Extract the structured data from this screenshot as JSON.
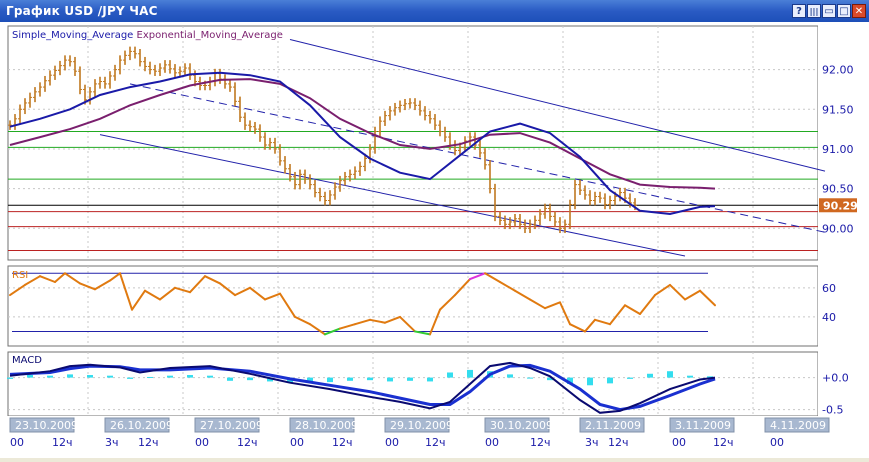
{
  "window": {
    "title": "График USD /JPY  ЧАС",
    "buttons": [
      "?",
      "|||",
      "▭",
      "□",
      "✕"
    ]
  },
  "colors": {
    "background": "#ffffff",
    "grid": "#c8c8c8",
    "price_bars": "#c07820",
    "sma": "#1a1aa8",
    "ema": "#7a1f6e",
    "channel": "#2222aa",
    "green_levels": "#22aa22",
    "red_levels": "#bb2222",
    "rsi": "#e07a10",
    "rsi_overbought": "#dd33dd",
    "rsi_oversold": "#33cc33",
    "macd_main": "#0a0a70",
    "macd_signal": "#1a30d0",
    "macd_hist": "#33ddee"
  },
  "chart_data": [
    {
      "type": "line",
      "title": "Simple_Moving_Average Exponential_Moving_Average",
      "legend": [
        "Simple_Moving_Average",
        "Exponential_Moving_Average"
      ],
      "ylim": [
        89.6,
        92.55
      ],
      "y_ticks": [
        "92.00",
        "91.50",
        "91.00",
        "90.50",
        "90.00"
      ],
      "last_price_label": "90.29",
      "horizontal_levels": {
        "green": [
          91.22,
          91.02,
          90.62
        ],
        "red": [
          90.21,
          90.02,
          89.72
        ],
        "black": [
          90.29
        ]
      },
      "x_axis_dates": [
        "23.10.2009",
        "26.10.2009",
        "27.10.2009",
        "28.10.2009",
        "29.10.2009",
        "30.10.2009",
        "2.11.2009",
        "3.11.2009",
        "4.11.2009"
      ],
      "x_axis_hours": [
        "00",
        "12ч",
        "3ч",
        "12ч",
        "00",
        "12ч",
        "00",
        "12ч",
        "00",
        "12ч",
        "00",
        "12ч",
        "3ч",
        "12ч",
        "00",
        "12ч",
        "00"
      ],
      "close_series": {
        "x": [
          0,
          5,
          10,
          15,
          20,
          25,
          30,
          35,
          40,
          45,
          50,
          55,
          60,
          65,
          70,
          75,
          80,
          85,
          90,
          95,
          100,
          105,
          110,
          115,
          120,
          125,
          130,
          135,
          140,
          145,
          150,
          155,
          160,
          165,
          170,
          175,
          180,
          185,
          190,
          195,
          200,
          205,
          210,
          215,
          220,
          225,
          230,
          235,
          240,
          245,
          250,
          255,
          260,
          265,
          270,
          275,
          280,
          285,
          290,
          295,
          300,
          305,
          310,
          315,
          320,
          325,
          330,
          335,
          340,
          345,
          350,
          355,
          360,
          365,
          370,
          375,
          380,
          385,
          390,
          395,
          400,
          405,
          410,
          415,
          420,
          425,
          430,
          435,
          440,
          445,
          450,
          455,
          460,
          465,
          470,
          475,
          480,
          485,
          490,
          495,
          500,
          505,
          510,
          515,
          520,
          525,
          530,
          535,
          540,
          545,
          550,
          555,
          560,
          565,
          570,
          575,
          580,
          585,
          590,
          595,
          600,
          605,
          610,
          615,
          620,
          625,
          630,
          635,
          640,
          645,
          650,
          655,
          660,
          665,
          670,
          675,
          680,
          685,
          690,
          695,
          700,
          705
        ],
        "values": [
          91.3,
          91.38,
          91.5,
          91.58,
          91.65,
          91.72,
          91.78,
          91.86,
          91.93,
          91.99,
          92.05,
          92.12,
          92.1,
          91.98,
          91.75,
          91.62,
          91.72,
          91.82,
          91.85,
          91.82,
          91.92,
          92.0,
          92.12,
          92.18,
          92.23,
          92.2,
          92.1,
          92.04,
          92.0,
          91.98,
          92.02,
          92.06,
          92.01,
          91.96,
          91.98,
          92.02,
          91.93,
          91.85,
          91.8,
          91.8,
          91.85,
          91.95,
          91.88,
          91.82,
          91.78,
          91.6,
          91.4,
          91.3,
          91.28,
          91.25,
          91.15,
          91.05,
          91.08,
          91.0,
          90.85,
          90.75,
          90.65,
          90.55,
          90.68,
          90.62,
          90.55,
          90.45,
          90.4,
          90.35,
          90.42,
          90.52,
          90.6,
          90.65,
          90.68,
          90.72,
          90.78,
          90.88,
          91.0,
          91.22,
          91.35,
          91.42,
          91.48,
          91.52,
          91.55,
          91.57,
          91.58,
          91.55,
          91.48,
          91.42,
          91.38,
          91.3,
          91.22,
          91.15,
          91.05,
          90.98,
          91.02,
          91.1,
          91.15,
          91.05,
          90.95,
          90.8,
          90.5,
          90.15,
          90.1,
          90.05,
          90.08,
          90.12,
          90.05,
          90.0,
          90.05,
          90.1,
          90.18,
          90.25,
          90.15,
          90.08,
          90.0,
          90.05,
          90.3,
          90.55,
          90.48,
          90.42,
          90.35,
          90.4,
          90.38,
          90.3,
          90.35,
          90.4,
          90.45,
          90.38,
          90.32,
          90.29
        ]
      },
      "sma_series": {
        "x": [
          0,
          30,
          60,
          90,
          120,
          150,
          180,
          210,
          240,
          270,
          300,
          330,
          360,
          390,
          420,
          450,
          480,
          510,
          540,
          570,
          600,
          630,
          660,
          690,
          705
        ],
        "values": [
          91.28,
          91.38,
          91.5,
          91.68,
          91.78,
          91.85,
          91.94,
          91.96,
          91.93,
          91.85,
          91.55,
          91.15,
          90.88,
          90.7,
          90.62,
          90.92,
          91.22,
          91.32,
          91.2,
          90.9,
          90.48,
          90.22,
          90.18,
          90.27,
          90.28
        ]
      },
      "ema_series": {
        "x": [
          0,
          30,
          60,
          90,
          120,
          150,
          180,
          210,
          240,
          270,
          300,
          330,
          360,
          390,
          420,
          450,
          480,
          510,
          540,
          570,
          600,
          630,
          660,
          690,
          705
        ],
        "values": [
          91.05,
          91.15,
          91.25,
          91.38,
          91.55,
          91.68,
          91.8,
          91.87,
          91.88,
          91.82,
          91.64,
          91.38,
          91.2,
          91.05,
          91.0,
          91.06,
          91.18,
          91.2,
          91.08,
          90.88,
          90.68,
          90.55,
          90.52,
          90.51,
          90.5
        ]
      },
      "channel_lines": [
        {
          "kind": "solid",
          "x": [
            280,
            815
          ],
          "y": [
            92.38,
            90.72
          ]
        },
        {
          "kind": "dashed",
          "x": [
            120,
            815
          ],
          "y": [
            91.82,
            89.95
          ]
        },
        {
          "kind": "solid",
          "x": [
            90,
            675
          ],
          "y": [
            91.18,
            89.65
          ]
        }
      ]
    },
    {
      "type": "line",
      "title": "RSI",
      "ylim": [
        20,
        75
      ],
      "y_ticks": [
        "60",
        "40"
      ],
      "levels": [
        70,
        30
      ],
      "series": [
        {
          "x": [
            0,
            15,
            30,
            45,
            55,
            70,
            85,
            100,
            110,
            122,
            135,
            150,
            165,
            180,
            195,
            210,
            225,
            240,
            255,
            270,
            285,
            300,
            315,
            330,
            345,
            360,
            375,
            390,
            405,
            420,
            430,
            445,
            460,
            475,
            490,
            505,
            520,
            535,
            550,
            560,
            575,
            585,
            600,
            615,
            630,
            645,
            660,
            675,
            690,
            705
          ],
          "values": [
            55,
            62,
            68,
            64,
            70,
            63,
            59,
            65,
            70,
            45,
            58,
            52,
            60,
            57,
            68,
            63,
            55,
            60,
            52,
            56,
            40,
            35,
            28,
            32,
            35,
            38,
            36,
            40,
            30,
            28,
            45,
            55,
            66,
            70,
            64,
            58,
            52,
            46,
            50,
            35,
            30,
            38,
            35,
            48,
            42,
            55,
            62,
            52,
            58,
            48
          ]
        }
      ]
    },
    {
      "type": "line",
      "title": "MACD",
      "ylim": [
        -0.6,
        0.4
      ],
      "y_ticks": [
        "+0.0",
        "-0.5"
      ],
      "series": [
        {
          "x": [
            0,
            40,
            60,
            80,
            110,
            130,
            160,
            200,
            240,
            280,
            320,
            360,
            390,
            420,
            440,
            460,
            480,
            500,
            520,
            540,
            570,
            590,
            610,
            630,
            660,
            690,
            705
          ],
          "values": [
            0.03,
            0.1,
            0.18,
            0.2,
            0.16,
            0.08,
            0.15,
            0.18,
            0.06,
            -0.08,
            -0.18,
            -0.3,
            -0.38,
            -0.48,
            -0.38,
            -0.1,
            0.18,
            0.23,
            0.15,
            0.02,
            -0.35,
            -0.55,
            -0.52,
            -0.4,
            -0.18,
            -0.03,
            0.0
          ]
        },
        {
          "x": [
            0,
            40,
            60,
            80,
            110,
            130,
            160,
            200,
            240,
            280,
            320,
            360,
            390,
            420,
            440,
            460,
            480,
            500,
            520,
            540,
            570,
            590,
            610,
            630,
            660,
            690,
            705
          ],
          "values": [
            0.05,
            0.08,
            0.14,
            0.18,
            0.17,
            0.12,
            0.12,
            0.15,
            0.1,
            -0.02,
            -0.12,
            -0.22,
            -0.32,
            -0.42,
            -0.42,
            -0.22,
            0.05,
            0.18,
            0.19,
            0.1,
            -0.18,
            -0.42,
            -0.5,
            -0.45,
            -0.28,
            -0.1,
            -0.02
          ]
        },
        {
          "x": [
            0,
            20,
            40,
            60,
            80,
            100,
            120,
            140,
            160,
            180,
            200,
            220,
            240,
            260,
            280,
            300,
            320,
            340,
            360,
            380,
            400,
            420,
            440,
            460,
            480,
            500,
            520,
            540,
            560,
            580,
            600,
            620,
            640,
            660,
            680,
            700
          ],
          "values": [
            -0.02,
            0.04,
            0.03,
            0.05,
            0.04,
            0.03,
            -0.02,
            0.01,
            0.03,
            0.04,
            0.03,
            -0.05,
            -0.04,
            -0.06,
            -0.08,
            -0.06,
            -0.07,
            -0.05,
            -0.04,
            -0.06,
            -0.05,
            -0.06,
            0.08,
            0.12,
            0.1,
            0.05,
            -0.01,
            -0.04,
            -0.1,
            -0.12,
            -0.09,
            -0.02,
            0.06,
            0.1,
            0.03,
            0.02
          ]
        }
      ]
    }
  ]
}
